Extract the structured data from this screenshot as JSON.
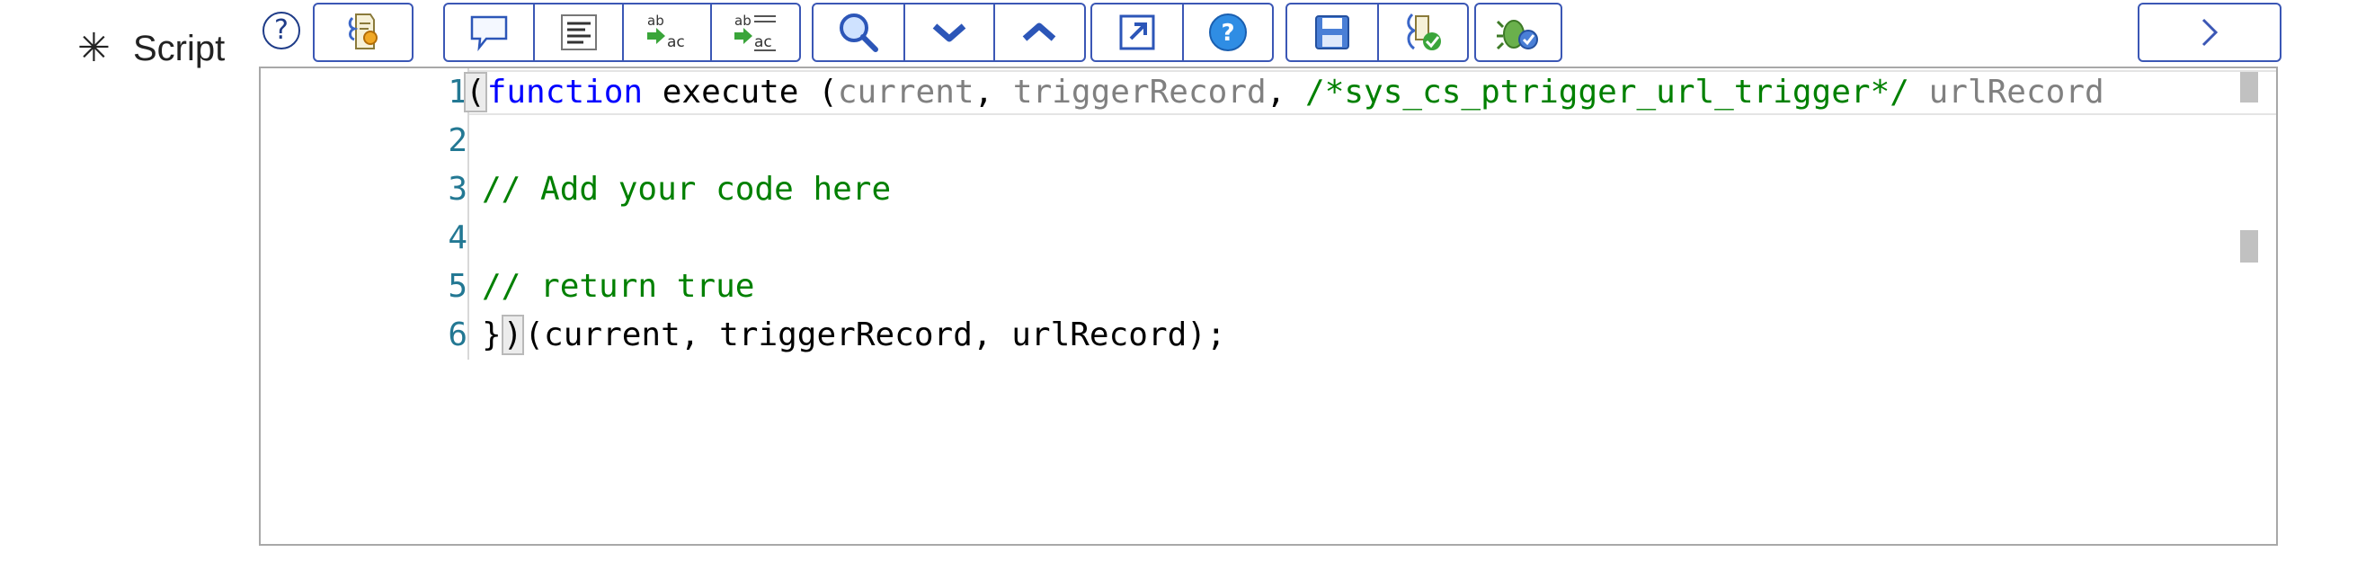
{
  "field": {
    "required_marker": "✳",
    "label": "Script",
    "help_icon_glyph": "?"
  },
  "toolbar": {
    "groups": [
      [
        "script-include-icon"
      ],
      [
        "comment-icon",
        "format-icon",
        "replace-icon",
        "replace-all-icon"
      ],
      [
        "search-icon",
        "find-next-icon",
        "find-previous-icon"
      ],
      [
        "fullscreen-icon",
        "help-icon"
      ],
      [
        "save-icon",
        "syntax-check-icon"
      ],
      [
        "debug-icon"
      ]
    ],
    "expand_glyph": "›"
  },
  "editor": {
    "line_numbers": [
      "1",
      "2",
      "3",
      "4",
      "5",
      "6"
    ],
    "lines": [
      [
        {
          "t": "(",
          "c": "tx"
        },
        {
          "t": "function",
          "c": "kw"
        },
        {
          "t": " execute (",
          "c": "tx"
        },
        {
          "t": "current",
          "c": "gr"
        },
        {
          "t": ", ",
          "c": "tx"
        },
        {
          "t": "triggerRecord",
          "c": "gr"
        },
        {
          "t": ", ",
          "c": "tx"
        },
        {
          "t": "/*sys_cs_ptrigger_url_trigger*/",
          "c": "cm"
        },
        {
          "t": " urlRecord",
          "c": "gr"
        }
      ],
      [],
      [
        {
          "t": "// Add your code here",
          "c": "cm"
        }
      ],
      [],
      [
        {
          "t": "// return true",
          "c": "cm"
        }
      ],
      [
        {
          "t": "}",
          "c": "tx"
        },
        {
          "t": ")",
          "c": "tx"
        },
        {
          "t": "(current, triggerRecord, urlRecord);",
          "c": "tx"
        }
      ]
    ]
  },
  "colors": {
    "keyword": "#0000ff",
    "comment": "#008000",
    "param": "#808080",
    "line_number": "#237893",
    "toolbar_border": "#3b57b5"
  }
}
